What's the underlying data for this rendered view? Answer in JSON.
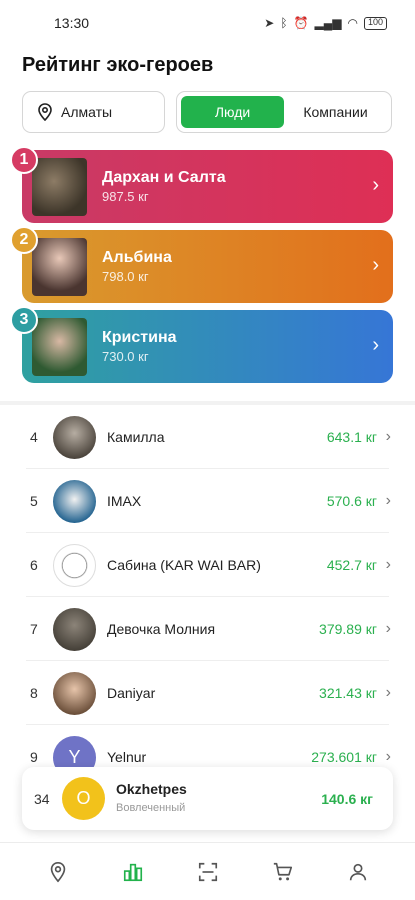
{
  "status_bar": {
    "time": "13:30",
    "battery": "100"
  },
  "page": {
    "title": "Рейтинг эко-героев"
  },
  "filters": {
    "city": "Алматы",
    "tabs": [
      {
        "label": "Люди",
        "active": true
      },
      {
        "label": "Компании",
        "active": false
      }
    ]
  },
  "top3": [
    {
      "rank": "1",
      "name": "Дархан и Салта",
      "weight": "987.5 кг"
    },
    {
      "rank": "2",
      "name": "Альбина",
      "weight": "798.0 кг"
    },
    {
      "rank": "3",
      "name": "Кристина",
      "weight": "730.0 кг"
    }
  ],
  "list": [
    {
      "rank": "4",
      "name": "Камилла",
      "weight": "643.1 кг"
    },
    {
      "rank": "5",
      "name": "IMAX",
      "weight": "570.6 кг"
    },
    {
      "rank": "6",
      "name": "Сабина (KAR WAI BAR)",
      "weight": "452.7 кг"
    },
    {
      "rank": "7",
      "name": "Девочка Молния",
      "weight": "379.89 кг"
    },
    {
      "rank": "8",
      "name": "Daniyar",
      "weight": "321.43 кг"
    },
    {
      "rank": "9",
      "name": "Yelnur",
      "weight": "273.601 кг",
      "initial": "Y"
    }
  ],
  "current_user": {
    "rank": "34",
    "initial": "O",
    "name": "Okzhetpes",
    "status": "Вовлеченный",
    "weight": "140.6 кг"
  },
  "colors": {
    "accent_green": "#22b24c",
    "gold_avatar": "#f2c21b"
  },
  "nav": {
    "icons": [
      "map-pin-icon",
      "rating-chart-icon",
      "scan-icon",
      "cart-icon",
      "profile-icon"
    ],
    "active": "rating-chart-icon"
  }
}
